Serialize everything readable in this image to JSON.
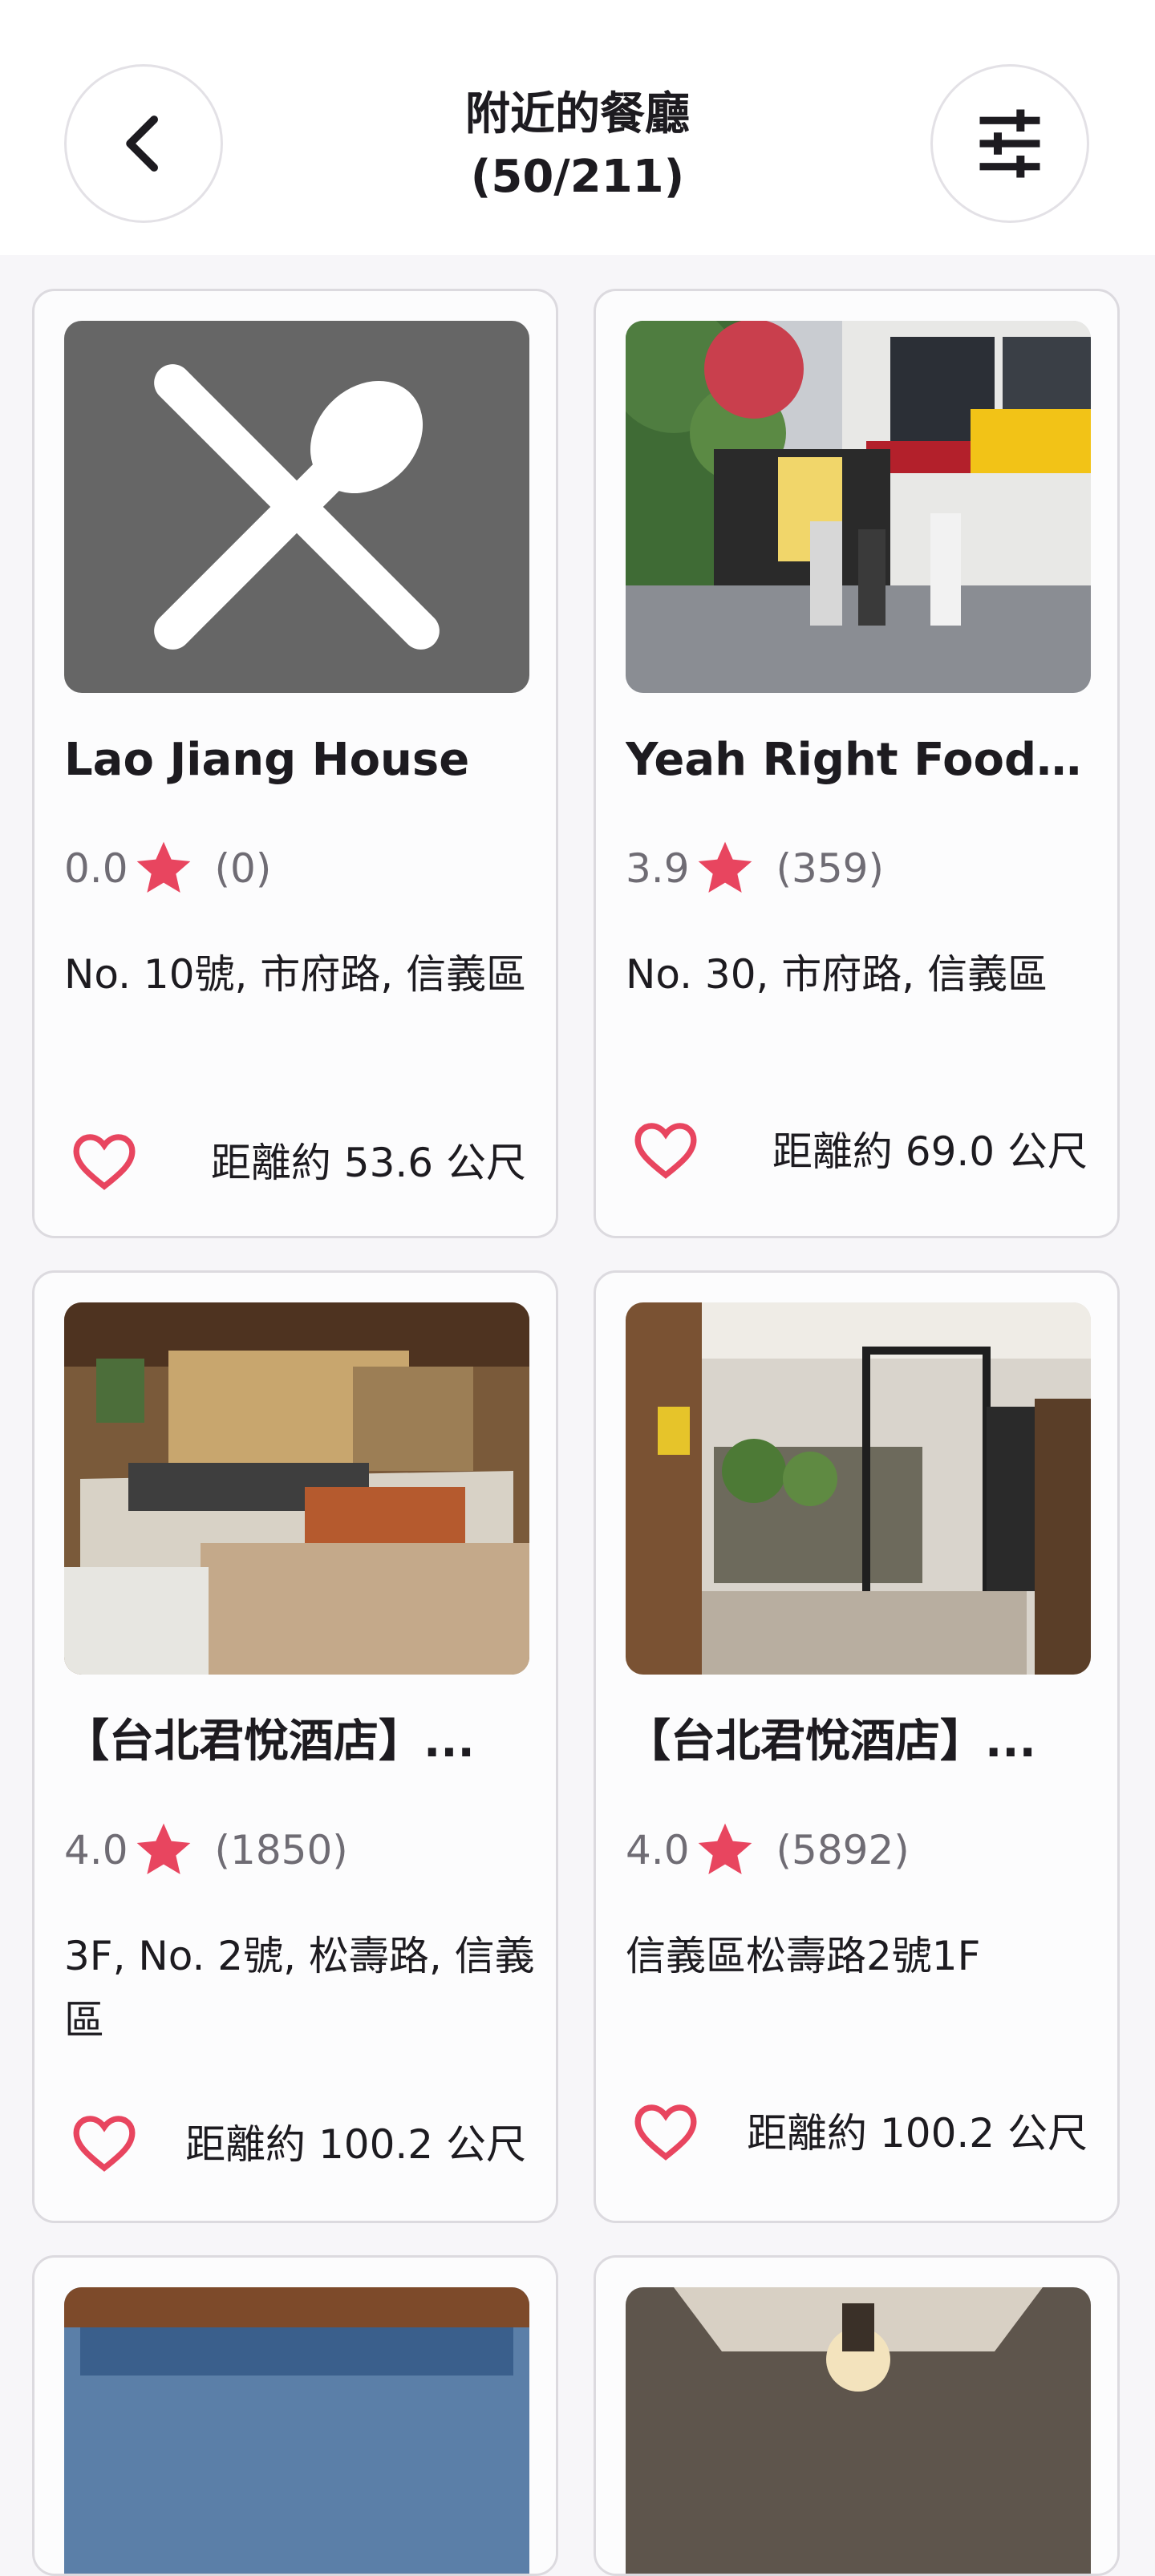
{
  "header": {
    "title_line1": "附近的餐廳",
    "title_line2": "(50/211)",
    "back_icon": "chevron-left-icon",
    "filter_icon": "tune-sliders-icon"
  },
  "colors": {
    "accent": "#e8455f",
    "placeholder_bg": "#666666",
    "rating_text": "#6f6c74"
  },
  "restaurants": [
    {
      "name": "Lao Jiang House",
      "rating": "0.0",
      "reviews": "(0)",
      "address": "No. 10號, 市府路, 信義區",
      "distance": "距離約 53.6 公尺",
      "image": "placeholder-utensils"
    },
    {
      "name": "Yeah Right Food T...",
      "rating": "3.9",
      "reviews": "(359)",
      "address": "No. 30, 市府路, 信義區",
      "distance": "距離約 69.0 公尺",
      "image": "food-truck-photo"
    },
    {
      "name": "【台北君悅酒店】...",
      "rating": "4.0",
      "reviews": "(1850)",
      "address": "3F, No. 2號, 松壽路, 信義區",
      "distance": "距離約 100.2 公尺",
      "image": "buffet-photo"
    },
    {
      "name": "【台北君悅酒店】...",
      "rating": "4.0",
      "reviews": "(5892)",
      "address": "信義區松壽路2號1F",
      "distance": "距離約 100.2 公尺",
      "image": "cafe-entrance-photo"
    },
    {
      "image": "interior-photo-partial"
    },
    {
      "image": "chandelier-photo-partial"
    }
  ]
}
